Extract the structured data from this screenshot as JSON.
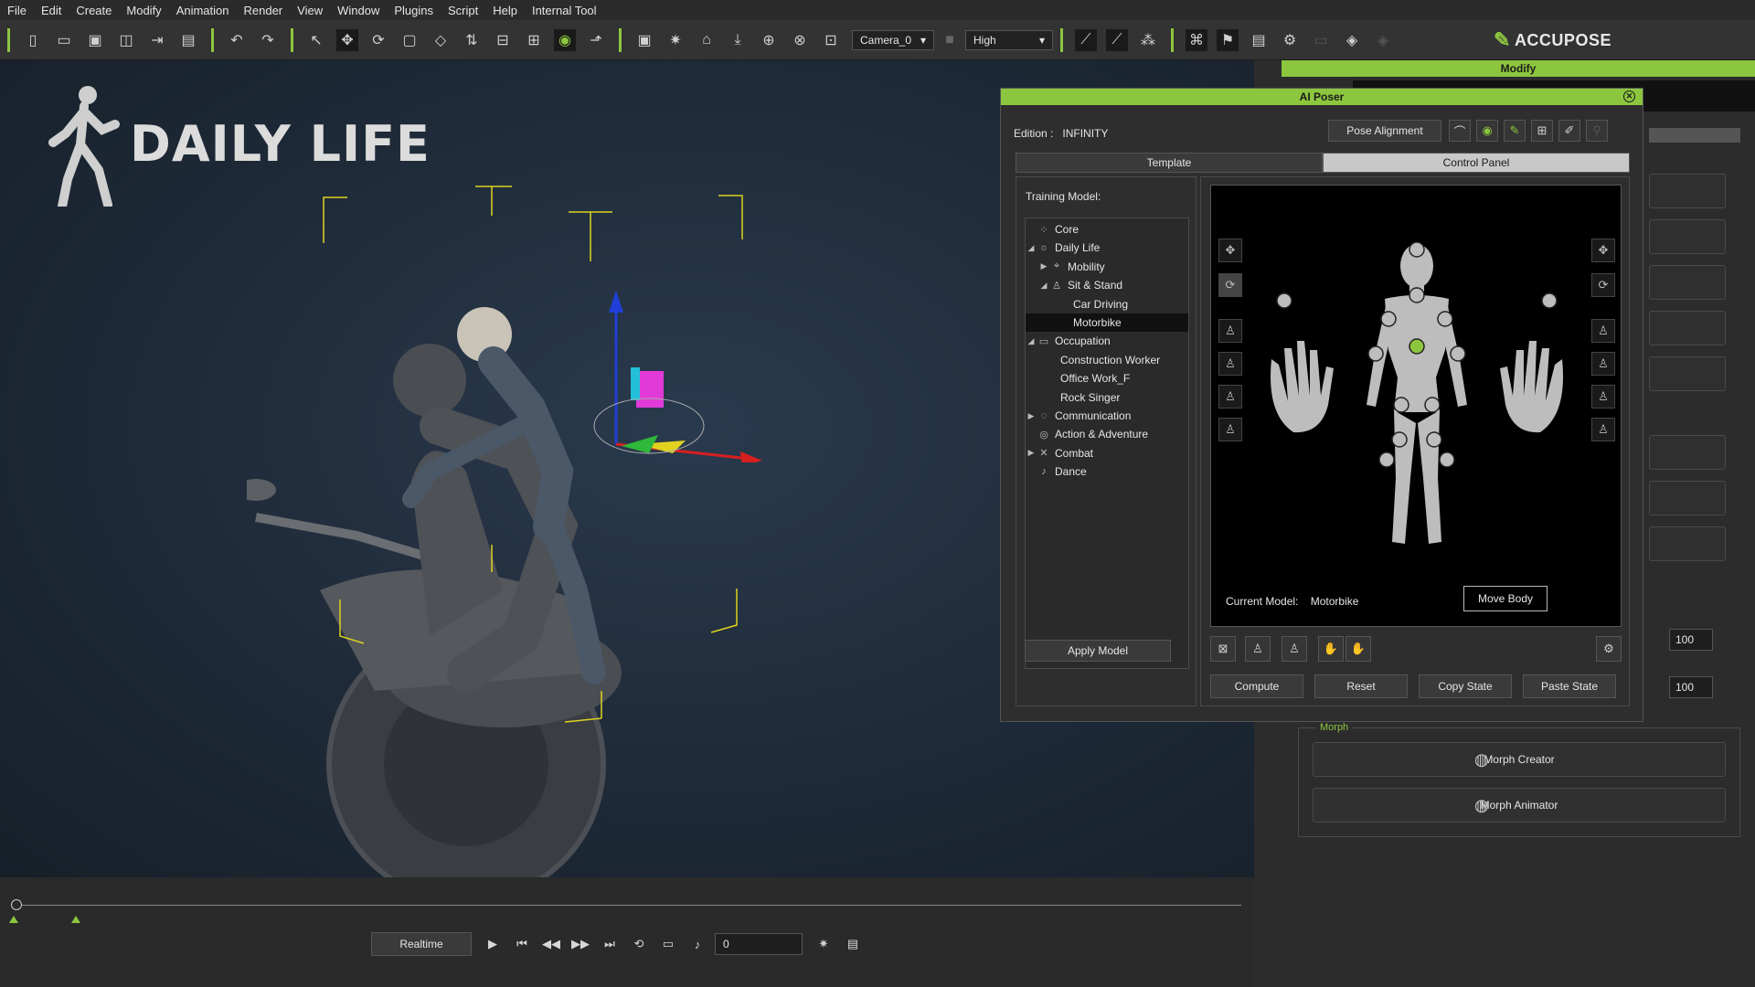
{
  "menu": [
    "File",
    "Edit",
    "Create",
    "Modify",
    "Animation",
    "Render",
    "View",
    "Window",
    "Plugins",
    "Script",
    "Help",
    "Internal Tool"
  ],
  "toolbar": {
    "camera": "Camera_0",
    "quality": "High",
    "brand": "ACCUPOSE"
  },
  "viewport": {
    "title": "DAILY LIFE"
  },
  "timeline": {
    "realtime_label": "Realtime",
    "frame": "0"
  },
  "right_panel": {
    "header": "Modify",
    "value_1": "100",
    "value_2": "100",
    "morph_group_label": "Morph",
    "morph_creator": "Morph Creator",
    "morph_animator": "Morph Animator"
  },
  "ai_poser": {
    "title": "AI Poser",
    "edition_label": "Edition :",
    "edition_value": "INFINITY",
    "pose_alignment": "Pose Alignment",
    "tabs": [
      "Template",
      "Control Panel"
    ],
    "training_model_label": "Training Model:",
    "tree": [
      {
        "label": "Core",
        "level": 0,
        "arrow": "",
        "icon": "core-icon"
      },
      {
        "label": "Daily Life",
        "level": 0,
        "arrow": "expanded",
        "icon": "daily-life-icon"
      },
      {
        "label": "Mobility",
        "level": 1,
        "arrow": "collapsed",
        "icon": "mobility-icon"
      },
      {
        "label": "Sit & Stand",
        "level": 1,
        "arrow": "expanded",
        "icon": "sit-stand-icon"
      },
      {
        "label": "Car Driving",
        "level": 2,
        "arrow": "",
        "icon": ""
      },
      {
        "label": "Motorbike",
        "level": 2,
        "arrow": "",
        "icon": "",
        "selected": true
      },
      {
        "label": "Occupation",
        "level": 0,
        "arrow": "expanded",
        "icon": "occupation-icon"
      },
      {
        "label": "Construction Worker",
        "level": 1,
        "arrow": "",
        "icon": ""
      },
      {
        "label": "Office Work_F",
        "level": 1,
        "arrow": "",
        "icon": ""
      },
      {
        "label": "Rock Singer",
        "level": 1,
        "arrow": "",
        "icon": ""
      },
      {
        "label": "Communication",
        "level": 0,
        "arrow": "collapsed",
        "icon": "communication-icon"
      },
      {
        "label": "Action & Adventure",
        "level": 0,
        "arrow": "",
        "icon": "action-icon"
      },
      {
        "label": "Combat",
        "level": 0,
        "arrow": "collapsed",
        "icon": "combat-icon"
      },
      {
        "label": "Dance",
        "level": 0,
        "arrow": "",
        "icon": "dance-icon"
      }
    ],
    "apply_model": "Apply Model",
    "current_model_label": "Current Model:",
    "current_model_value": "Motorbike",
    "move_body": "Move Body",
    "compute": "Compute",
    "reset": "Reset",
    "copy_state": "Copy State",
    "paste_state": "Paste State"
  },
  "colors": {
    "accent": "#8cc63f",
    "selected_joint": "#8cc63f"
  }
}
